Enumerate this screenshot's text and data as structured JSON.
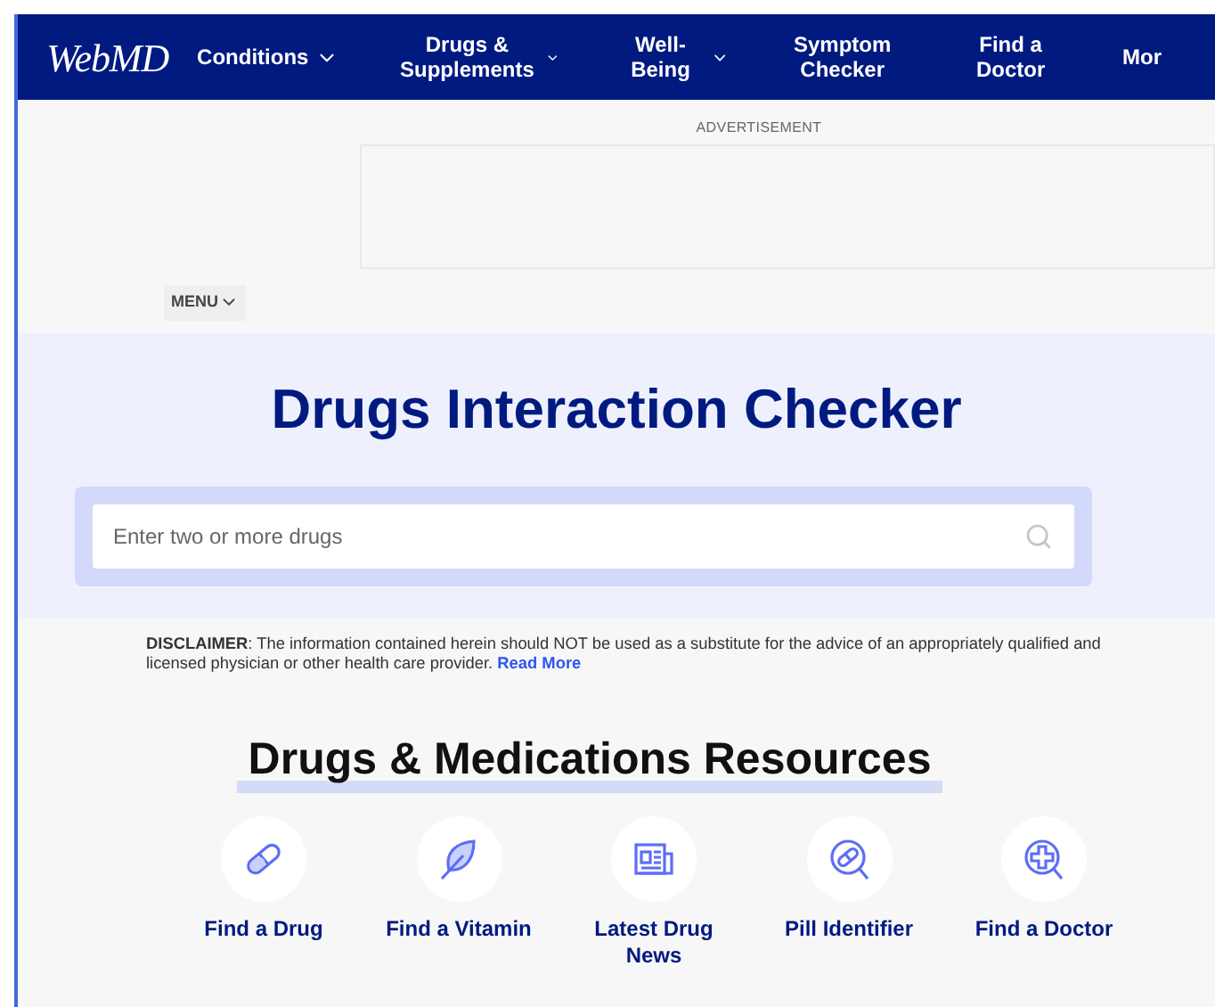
{
  "header": {
    "logo": "WebMD",
    "nav": [
      {
        "label": "Conditions",
        "dropdown": true
      },
      {
        "label": "Drugs & Supplements",
        "dropdown": true
      },
      {
        "label": "Well-Being",
        "dropdown": true
      },
      {
        "label": "Symptom Checker",
        "dropdown": false
      },
      {
        "label": "Find a Doctor",
        "dropdown": false
      },
      {
        "label": "Mor",
        "dropdown": false
      }
    ]
  },
  "advertisement": {
    "label": "ADVERTISEMENT"
  },
  "menu": {
    "label": "MENU"
  },
  "hero": {
    "title": "Drugs Interaction Checker",
    "search": {
      "placeholder": "Enter two or more drugs"
    }
  },
  "disclaimer": {
    "text": "**DISCLAIMER**: The information contained herein should NOT be used as a substitute for the advice of an appropriately qualified and licensed physician or other health care provider.",
    "link": "Read More"
  },
  "resources": {
    "title": "Drugs & Medications Resources",
    "items": [
      {
        "kind": "pill",
        "label": "Find a Drug"
      },
      {
        "kind": "leaf",
        "label": "Find a Vitamin"
      },
      {
        "kind": "news",
        "label": "Latest Drug News"
      },
      {
        "kind": "pill-search",
        "label": "Pill Identifier"
      },
      {
        "kind": "doctor-search",
        "label": "Find a Doctor"
      }
    ]
  }
}
